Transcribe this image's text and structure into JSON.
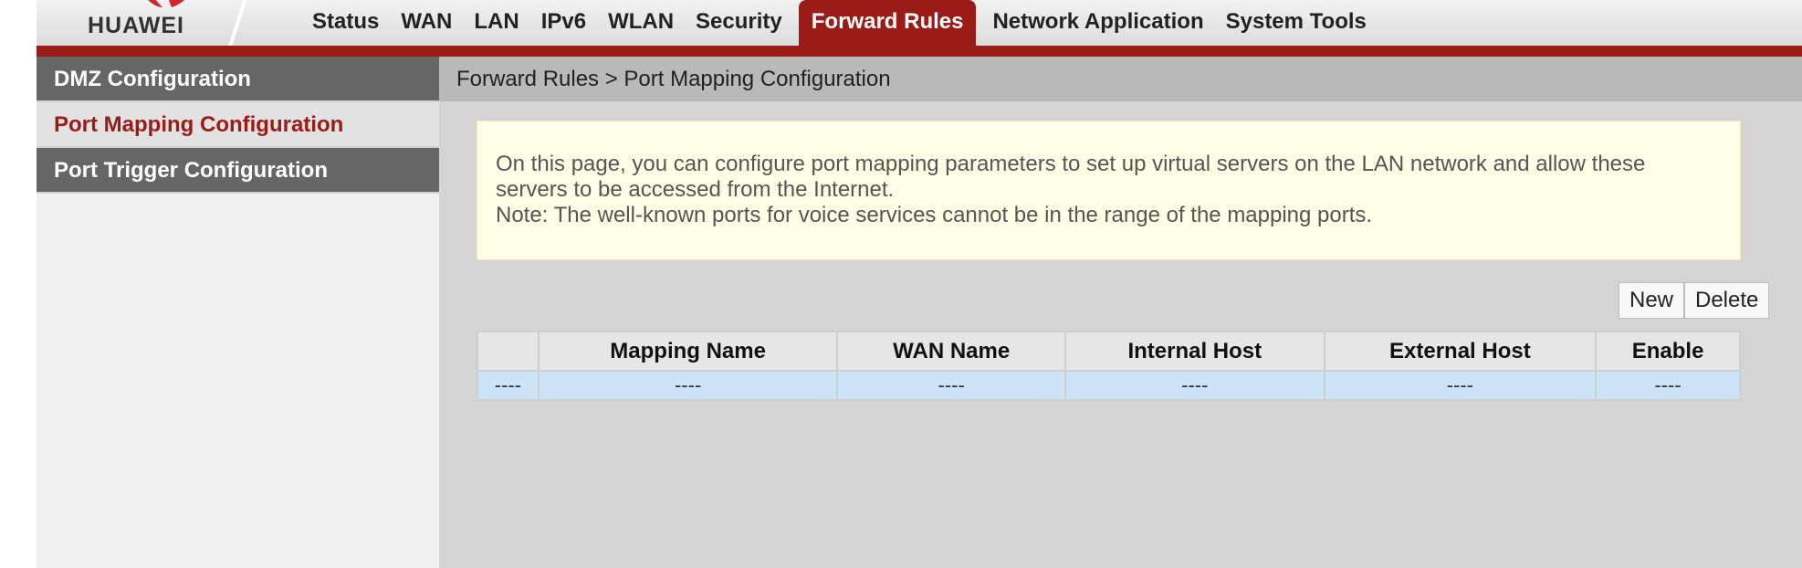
{
  "brand": {
    "logo_text": "HUAWEI",
    "accent_color": "#9b1b17"
  },
  "nav": {
    "tabs": [
      {
        "label": "Status"
      },
      {
        "label": "WAN"
      },
      {
        "label": "LAN"
      },
      {
        "label": "IPv6"
      },
      {
        "label": "WLAN"
      },
      {
        "label": "Security"
      },
      {
        "label": "Forward Rules",
        "active": true
      },
      {
        "label": "Network Application"
      },
      {
        "label": "System Tools"
      }
    ]
  },
  "sidebar": {
    "items": [
      {
        "label": "DMZ Configuration"
      },
      {
        "label": "Port Mapping Configuration",
        "selected": true
      },
      {
        "label": "Port Trigger Configuration"
      }
    ]
  },
  "main": {
    "breadcrumb": "Forward Rules > Port Mapping Configuration",
    "notice": {
      "line1": "On this page, you can configure port mapping parameters to set up virtual servers on the LAN network and allow these servers to be accessed from the Internet.",
      "line2": "Note: The well-known ports for voice services cannot be in the range of the mapping ports."
    },
    "buttons": {
      "new_label": "New",
      "delete_label": "Delete"
    },
    "table": {
      "headers": [
        "",
        "Mapping Name",
        "WAN Name",
        "Internal Host",
        "External Host",
        "Enable"
      ],
      "rows": [
        [
          "----",
          "----",
          "----",
          "----",
          "----",
          "----"
        ]
      ]
    }
  }
}
